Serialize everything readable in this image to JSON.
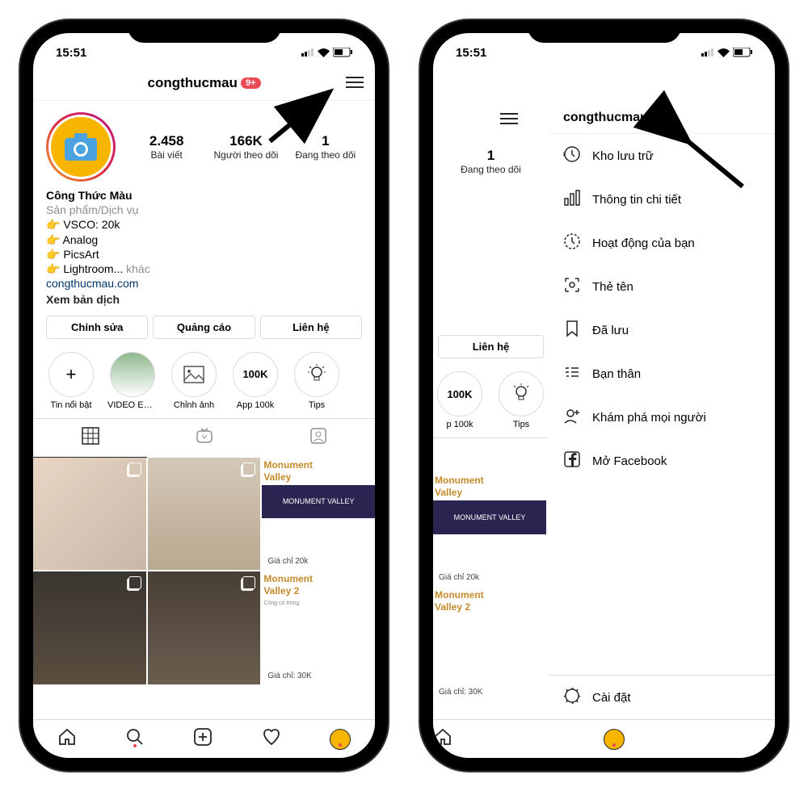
{
  "status": {
    "time": "15:51"
  },
  "profile": {
    "username": "congthucmau",
    "badge": "9+",
    "stats": {
      "posts_num": "2.458",
      "posts_label": "Bài viết",
      "followers_num": "166K",
      "followers_label": "Người theo dõi",
      "following_num": "1",
      "following_label": "Đang theo dõi"
    },
    "bio": {
      "name": "Công Thức Màu",
      "category": "Sản phẩm/Dịch vụ",
      "line1": "👉 VSCO: 20k",
      "line2": "👉 Analog",
      "line3": "👉 PicsArt",
      "line4": "👉 Lightroom...",
      "more": "khác",
      "link": "congthucmau.com",
      "translate": "Xem bản dịch"
    },
    "buttons": {
      "edit": "Chỉnh sửa",
      "promote": "Quảng cáo",
      "contact": "Liên hệ"
    },
    "highlights": {
      "h0": "Tin nổi bật",
      "h1": "VIDEO EDIT...",
      "h2": "Chỉnh ảnh",
      "h3": "App 100k",
      "h4": "Tips",
      "h3_icon": "100K"
    },
    "posts": {
      "p2_title": "Monument",
      "p2_sub": "Valley",
      "p2_banner": "MONUMENT VALLEY",
      "p2_price": "Giá chỉ 20k",
      "p5_title": "Monument",
      "p5_sub": "Valley 2",
      "p5_mid": "Cũng có trong",
      "p5_price": "Giá chỉ: 30K"
    }
  },
  "panel2": {
    "username": "congthucmau",
    "stat_left_num": "1",
    "stat_left_label": "Đang theo dõi",
    "contact": "Liên hệ",
    "hl3": "p 100k",
    "hl4": "Tips",
    "p2_price": "Giá chỉ 20k",
    "p5_price": "Giá chỉ: 30K"
  },
  "menu": {
    "archive": "Kho lưu trữ",
    "insights": "Thông tin chi tiết",
    "activity": "Hoạt động của bạn",
    "nametag": "Thẻ tên",
    "saved": "Đã lưu",
    "close_friends": "Bạn thân",
    "discover": "Khám phá mọi người",
    "facebook": "Mở Facebook",
    "settings": "Cài đặt"
  }
}
